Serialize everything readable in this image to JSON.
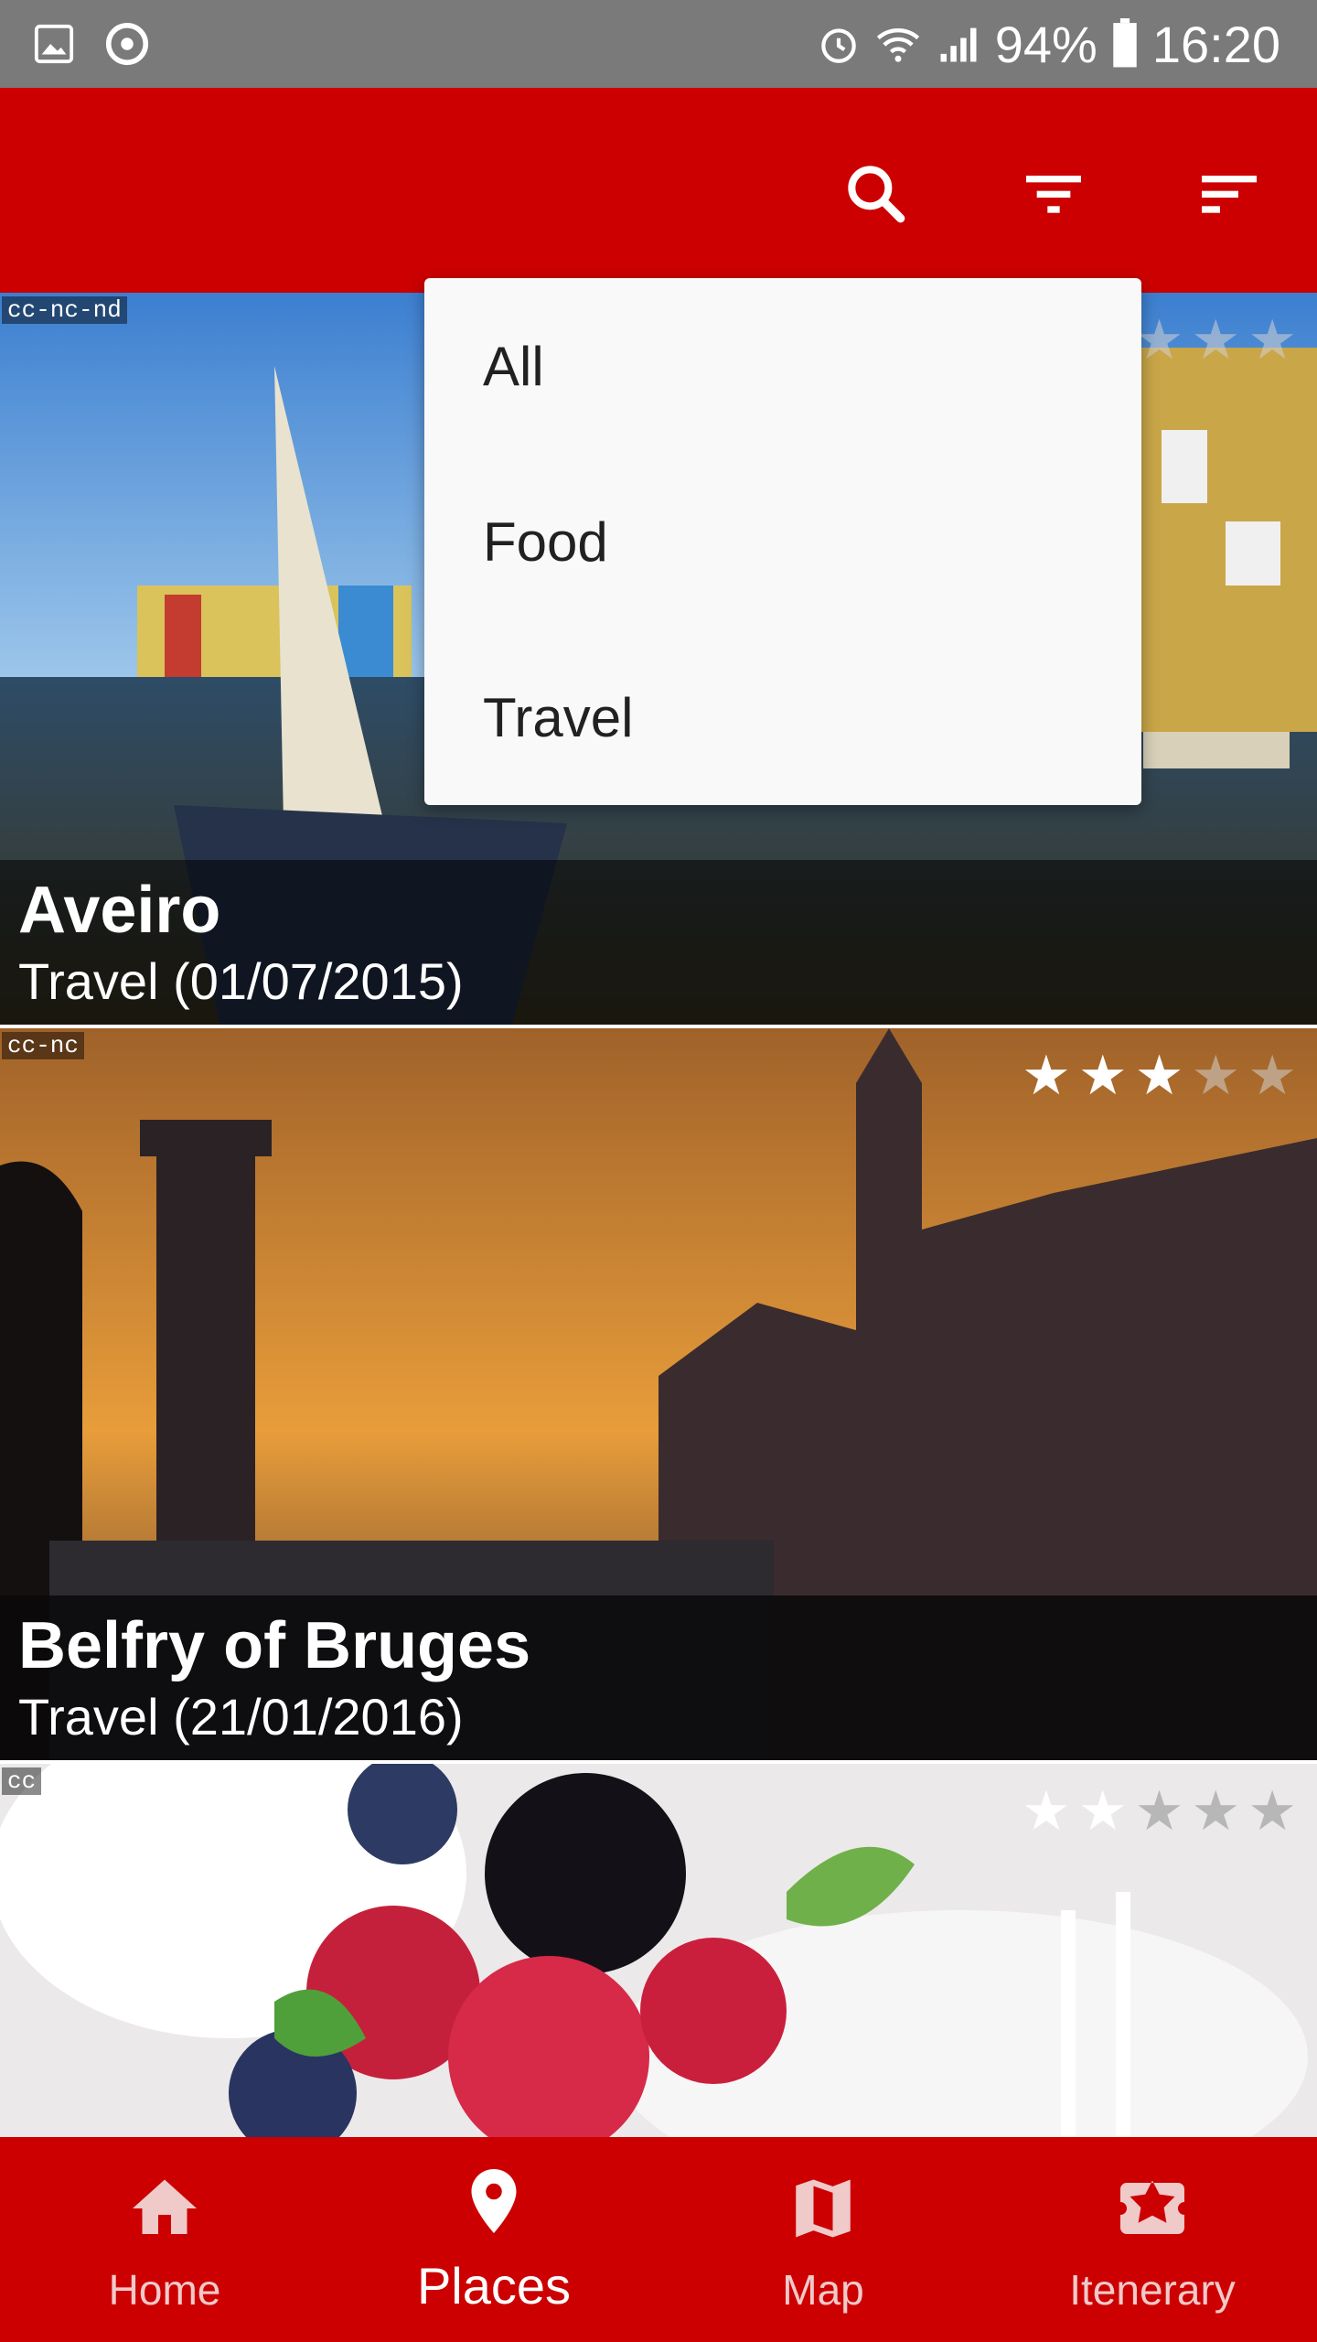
{
  "status_bar": {
    "battery": "94%",
    "time": "16:20",
    "left_icons": [
      "gallery-icon",
      "sync-icon"
    ],
    "right_icons": [
      "alarm-icon",
      "wifi-icon",
      "signal-icon",
      "battery-icon"
    ]
  },
  "app_bar": {
    "actions": [
      "search-icon",
      "filter-icon",
      "sort-icon"
    ]
  },
  "filter_menu": {
    "items": [
      "All",
      "Food",
      "Travel"
    ]
  },
  "places": [
    {
      "title": "Aveiro",
      "subtitle": "Travel (01/07/2015)",
      "license": "cc-nc-nd",
      "rating": 3,
      "max_rating": 5
    },
    {
      "title": "Belfry of Bruges",
      "subtitle": "Travel (21/01/2016)",
      "license": "cc-nc",
      "rating": 3,
      "max_rating": 5
    },
    {
      "title": "",
      "subtitle": "",
      "license": "cc",
      "rating": 2,
      "max_rating": 5
    }
  ],
  "bottom_nav": {
    "items": [
      {
        "label": "Home",
        "icon": "home-icon"
      },
      {
        "label": "Places",
        "icon": "place-pin-icon"
      },
      {
        "label": "Map",
        "icon": "map-icon"
      },
      {
        "label": "Itenerary",
        "icon": "ticket-star-icon"
      }
    ],
    "active": "Places"
  },
  "colors": {
    "primary": "#cc0000",
    "status_bar": "#7a7a7a",
    "menu_bg": "#f9f9f9",
    "text_dark": "#212121",
    "white": "#ffffff"
  }
}
